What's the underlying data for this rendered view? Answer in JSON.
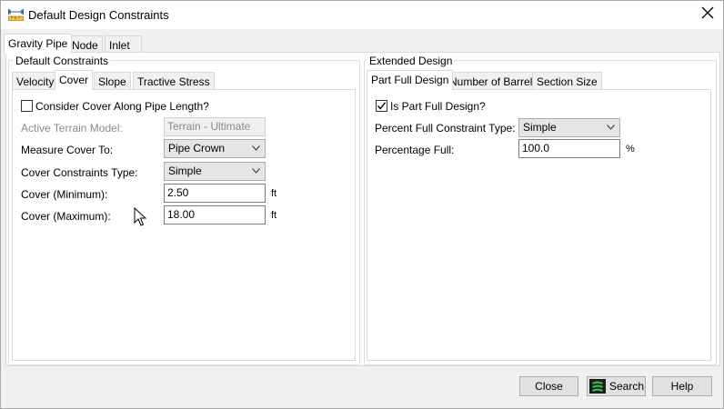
{
  "window": {
    "title": "Default Design Constraints",
    "title_icon": "ruler-icon",
    "close_icon": "close-icon"
  },
  "main_tabs": [
    {
      "label": "Gravity Pipe",
      "active": true
    },
    {
      "label": "Node",
      "active": false
    },
    {
      "label": "Inlet",
      "active": false
    }
  ],
  "default_constraints": {
    "group_label": "Default Constraints",
    "tabs": [
      {
        "label": "Velocity",
        "active": false
      },
      {
        "label": "Cover",
        "active": true
      },
      {
        "label": "Slope",
        "active": false
      },
      {
        "label": "Tractive Stress",
        "active": false
      }
    ],
    "consider_cover": {
      "label": "Consider Cover Along Pipe Length?",
      "checked": false
    },
    "active_terrain_model": {
      "label": "Active Terrain Model:",
      "value": "Terrain - Ultimate",
      "enabled": false
    },
    "measure_cover_to": {
      "label": "Measure Cover To:",
      "value": "Pipe Crown"
    },
    "cover_constraints_type": {
      "label": "Cover Constraints Type:",
      "value": "Simple"
    },
    "cover_minimum": {
      "label": "Cover (Minimum):",
      "value": "2.50",
      "unit": "ft"
    },
    "cover_maximum": {
      "label": "Cover (Maximum):",
      "value": "18.00",
      "unit": "ft"
    }
  },
  "extended_design": {
    "group_label": "Extended Design",
    "tabs": [
      {
        "label": "Part Full Design",
        "active": true
      },
      {
        "label": "Number of Barrels",
        "active": false
      },
      {
        "label": "Section Size",
        "active": false
      }
    ],
    "is_part_full": {
      "label": "Is Part Full Design?",
      "checked": true
    },
    "percent_full_constraint_type": {
      "label": "Percent Full Constraint Type:",
      "value": "Simple"
    },
    "percentage_full": {
      "label": "Percentage Full:",
      "value": "100.0",
      "unit": "%"
    }
  },
  "buttons": {
    "close": "Close",
    "search": "Search",
    "help": "Help"
  }
}
